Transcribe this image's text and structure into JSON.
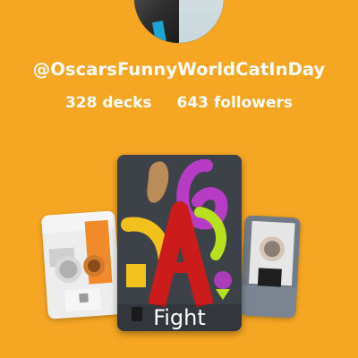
{
  "profile": {
    "handle": "@OscarsFunnyWorldCatInDay",
    "decks": "328 decks",
    "followers": "643 followers"
  },
  "decks": {
    "featured": {
      "label": "Fight"
    }
  },
  "colors": {
    "background": "#F5A623",
    "text": "#FFFFFF"
  }
}
